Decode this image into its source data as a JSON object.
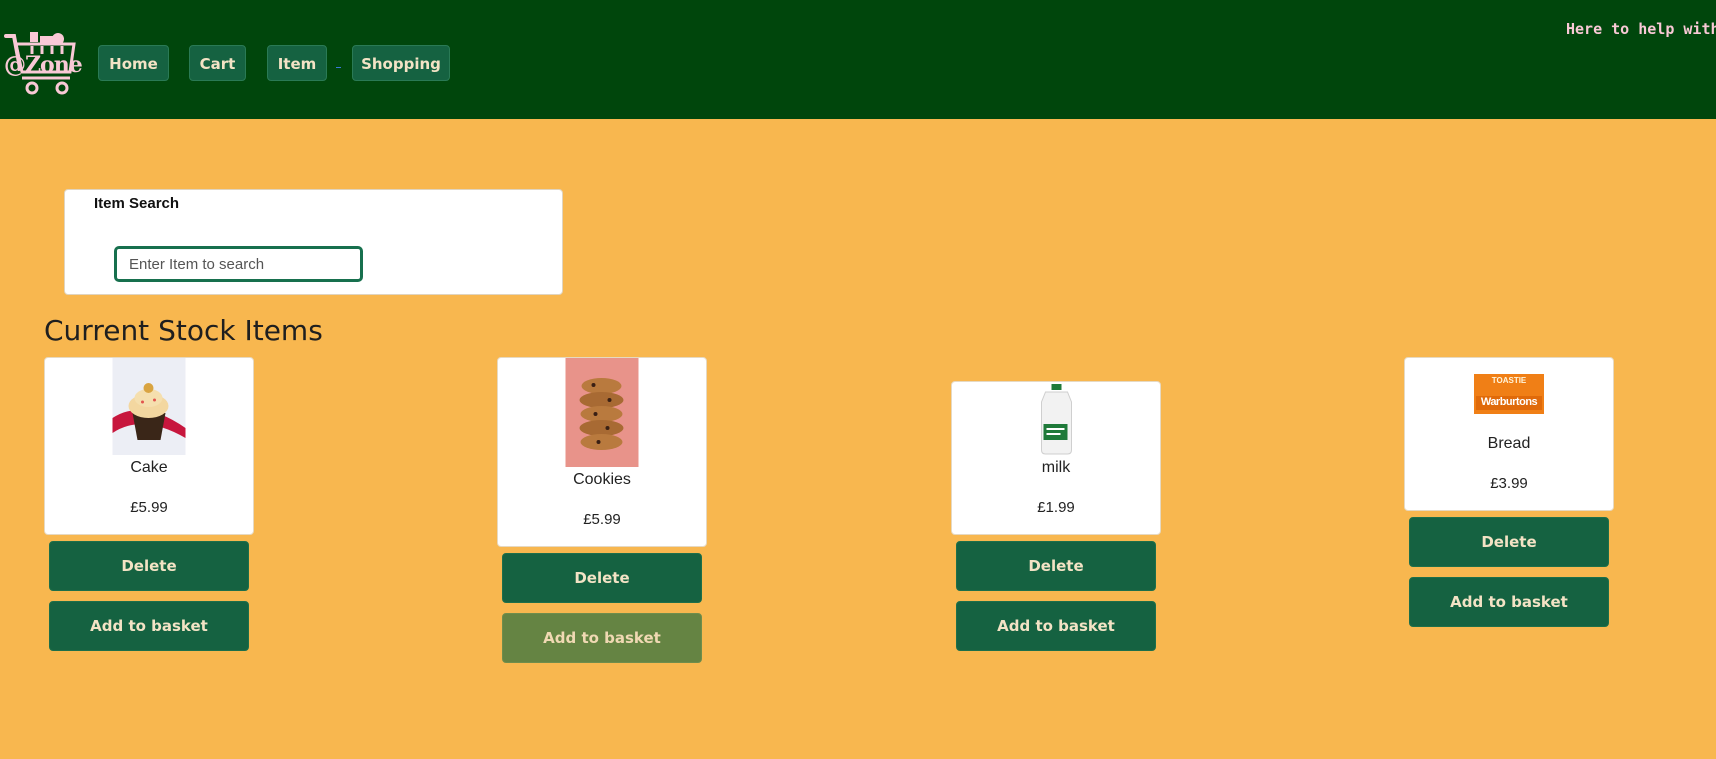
{
  "header": {
    "logo_text": "@Zone",
    "tagline": "Here to help with t",
    "nav": [
      {
        "label": "Home"
      },
      {
        "label": "Cart"
      },
      {
        "label": "Item"
      },
      {
        "label": "Shopping"
      }
    ]
  },
  "search": {
    "label": "Item Search",
    "placeholder": "Enter Item to search",
    "value": ""
  },
  "main": {
    "title": "Current Stock Items"
  },
  "products": [
    {
      "name": "Cake",
      "price": "£5.99",
      "delete_label": "Delete",
      "basket_label": "Add to basket"
    },
    {
      "name": "Cookies",
      "price": "£5.99",
      "delete_label": "Delete",
      "basket_label": "Add to basket"
    },
    {
      "name": "milk",
      "price": "£1.99",
      "delete_label": "Delete",
      "basket_label": "Add to basket"
    },
    {
      "name": "Bread",
      "price": "£3.99",
      "delete_label": "Delete",
      "basket_label": "Add to basket",
      "brand_text": "Warburtons",
      "brand_subtext": "TOASTIE"
    }
  ],
  "colors": {
    "header_bg": "#00460c",
    "page_bg": "#f8b74f",
    "button_bg": "#156241",
    "button_hover_bg": "#658443",
    "button_text": "#f3e3c5",
    "tagline": "#f9c9d6"
  }
}
